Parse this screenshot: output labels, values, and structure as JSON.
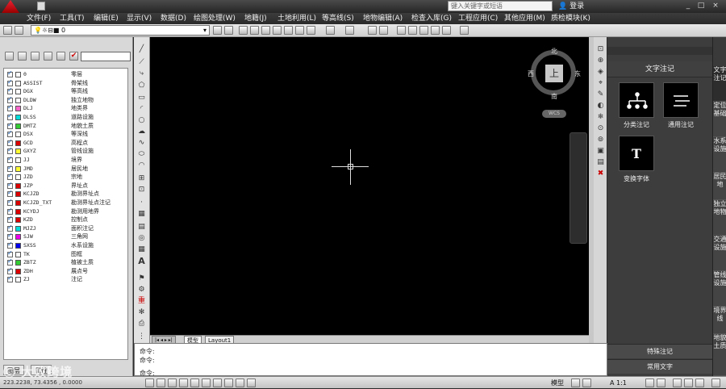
{
  "titlebar": {
    "search_placeholder": "键入关键字或短语",
    "login_label": "登录",
    "minimize": "_",
    "maximize": "□",
    "close": "×"
  },
  "menu": [
    "文件(F)",
    "工具(T)",
    "编辑(E)",
    "显示(V)",
    "数据(D)",
    "绘图处理(W)",
    "地籍(J)",
    "土地利用(L)",
    "等高线(S)",
    "地物编辑(A)",
    "检查入库(G)",
    "工程应用(C)",
    "其他应用(M)",
    "质检模块(K)"
  ],
  "toolbar": {
    "layer_value": "0"
  },
  "layers": [
    {
      "name": "0",
      "desc": "零层",
      "color": "#ffffff"
    },
    {
      "name": "ASSIST",
      "desc": "骨架线",
      "color": "#ffffff"
    },
    {
      "name": "DGX",
      "desc": "等高线",
      "color": "#ffffff"
    },
    {
      "name": "DLDW",
      "desc": "独立地物",
      "color": "#ffffff"
    },
    {
      "name": "DLJ",
      "desc": "地类界",
      "color": "#ff66cc"
    },
    {
      "name": "DLSS",
      "desc": "道路设施",
      "color": "#00dddd"
    },
    {
      "name": "DMTZ",
      "desc": "地貌土质",
      "color": "#33cc33"
    },
    {
      "name": "DSX",
      "desc": "等深线",
      "color": "#ffffff"
    },
    {
      "name": "GCD",
      "desc": "高程点",
      "color": "#dd0000"
    },
    {
      "name": "GXYZ",
      "desc": "管线设施",
      "color": "#ffff33"
    },
    {
      "name": "JJ",
      "desc": "境界",
      "color": "#ffffff"
    },
    {
      "name": "JMD",
      "desc": "居民地",
      "color": "#ffff33"
    },
    {
      "name": "JZD",
      "desc": "宗地",
      "color": "#ffffff"
    },
    {
      "name": "JZP",
      "desc": "界址点",
      "color": "#dd0000"
    },
    {
      "name": "KCJZD",
      "desc": "勘测界址点",
      "color": "#dd0000"
    },
    {
      "name": "KCJZD_TXT",
      "desc": "勘测界址点注记",
      "color": "#dd0000"
    },
    {
      "name": "KCYDJ",
      "desc": "勘测用地界",
      "color": "#dd0000"
    },
    {
      "name": "KZD",
      "desc": "控制点",
      "color": "#dd0000"
    },
    {
      "name": "MJZJ",
      "desc": "面积注记",
      "color": "#00dddd"
    },
    {
      "name": "SJW",
      "desc": "三角网",
      "color": "#ee00ee"
    },
    {
      "name": "SXSS",
      "desc": "水系设施",
      "color": "#0000ee"
    },
    {
      "name": "TK",
      "desc": "图框",
      "color": "#ffffff"
    },
    {
      "name": "ZBTZ",
      "desc": "植被土质",
      "color": "#33cc33"
    },
    {
      "name": "ZDH",
      "desc": "展点号",
      "color": "#dd0000"
    },
    {
      "name": "ZJ",
      "desc": "注记",
      "color": "#ffffff"
    }
  ],
  "left_tabs": [
    "图层",
    "属性"
  ],
  "viewcube": {
    "top": "上",
    "north": "北",
    "south": "南",
    "east": "东",
    "west": "西",
    "wcs": "WCS"
  },
  "layout_tabs": [
    "模型",
    "Layout1"
  ],
  "command": {
    "line1": "命令:",
    "line2": "命令:",
    "line3": "命令:"
  },
  "status": {
    "coords": "223.2238,  73.4356 ,  0.0000",
    "model": "模型",
    "scale": "A 1:1"
  },
  "right_panel": {
    "title": "文字注记",
    "tools": [
      {
        "label": "分类注记",
        "icon": "tree-icon"
      },
      {
        "label": "通用注记",
        "icon": "lines-icon"
      },
      {
        "label": "变换字体",
        "icon": "text-t-icon",
        "glyph": "T"
      }
    ],
    "bottom_buttons": [
      "特殊注记",
      "常用文字"
    ]
  },
  "right_tabs": [
    "文字注记",
    "定位基础",
    "水系设施",
    "居民地",
    "独立地物",
    "交通设施",
    "管线设施",
    "境界线",
    "地貌土质"
  ],
  "watermark": "大败跨境"
}
